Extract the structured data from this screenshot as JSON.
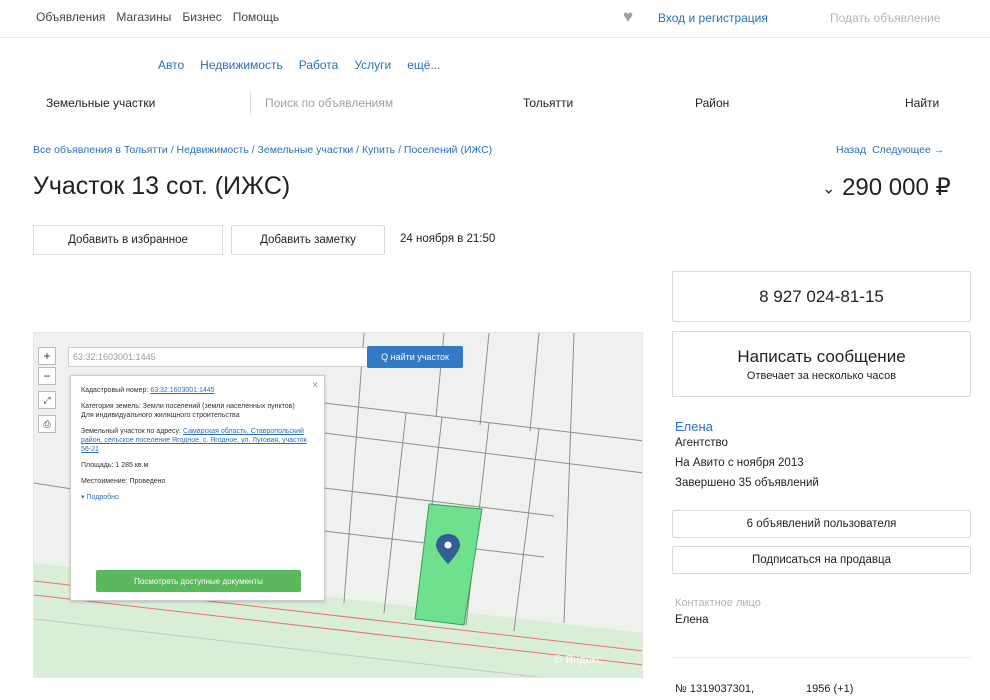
{
  "topnav": {
    "items": [
      "Объявления",
      "Магазины",
      "Бизнес",
      "Помощь"
    ],
    "login": "Вход и регистрация",
    "post_ad": "Подать объявление"
  },
  "categories": [
    "Авто",
    "Недвижимость",
    "Работа",
    "Услуги",
    "ещё..."
  ],
  "search": {
    "category": "Земельные участки",
    "placeholder": "Поиск по объявлениям",
    "city": "Тольятти",
    "region": "Район",
    "find": "Найти"
  },
  "breadcrumb": "Все объявления в Тольятти / Недвижимость / Земельные участки / Купить / Поселений (ИЖС)",
  "nav": {
    "back": "Назад",
    "next": "Следующее →"
  },
  "listing": {
    "title": "Участок 13 сот. (ИЖС)",
    "price": "290 000 ₽",
    "price_arrow": "⌄",
    "add_favorite": "Добавить в избранное",
    "add_note": "Добавить заметку",
    "date": "24 ноября в 21:50",
    "ad_number": "№ 1319037301,",
    "views": "1956 (+1)"
  },
  "contact": {
    "phone": "8 927 024-81-15",
    "message": "Написать сообщение",
    "message_sub": "Отвечает за несколько часов",
    "seller_name": "Елена",
    "seller_type": "Агентство",
    "since": "На Авито с ноября 2013",
    "completed": "Завершено 35 объявлений",
    "user_ads": "6 объявлений пользователя",
    "subscribe": "Подписаться на продавца",
    "contact_label": "Контактное лицо",
    "contact_name": "Елена"
  },
  "map": {
    "search_value": "63:32:1603001:1445",
    "find_button": "Q найти участок",
    "zoom_in": "+",
    "zoom_out": "−",
    "popup": {
      "cadastral_label": "Кадастровый номер:",
      "cadastral_value": "63:32:1603001:1445",
      "category_label": "Категория земель:",
      "category_value": "Земли поселений (земли населенных пунктов)",
      "usage": "Для индивидуального жилищного строительства",
      "address_label": "Земельный участок по адресу:",
      "address_value": "Самарская область, Ставропольский район, сельское поселение Ягодное, с. Ягодное, ул. Луговая, участок 56-21",
      "area": "Площадь: 1 285 кв.м",
      "layer": "Местоимение: Проведено",
      "more": "▾ Подробно",
      "docs_button": "Посмотреть доступные документы"
    },
    "watermark": "© Яндекс",
    "highlight_color": "#6fe08e"
  }
}
